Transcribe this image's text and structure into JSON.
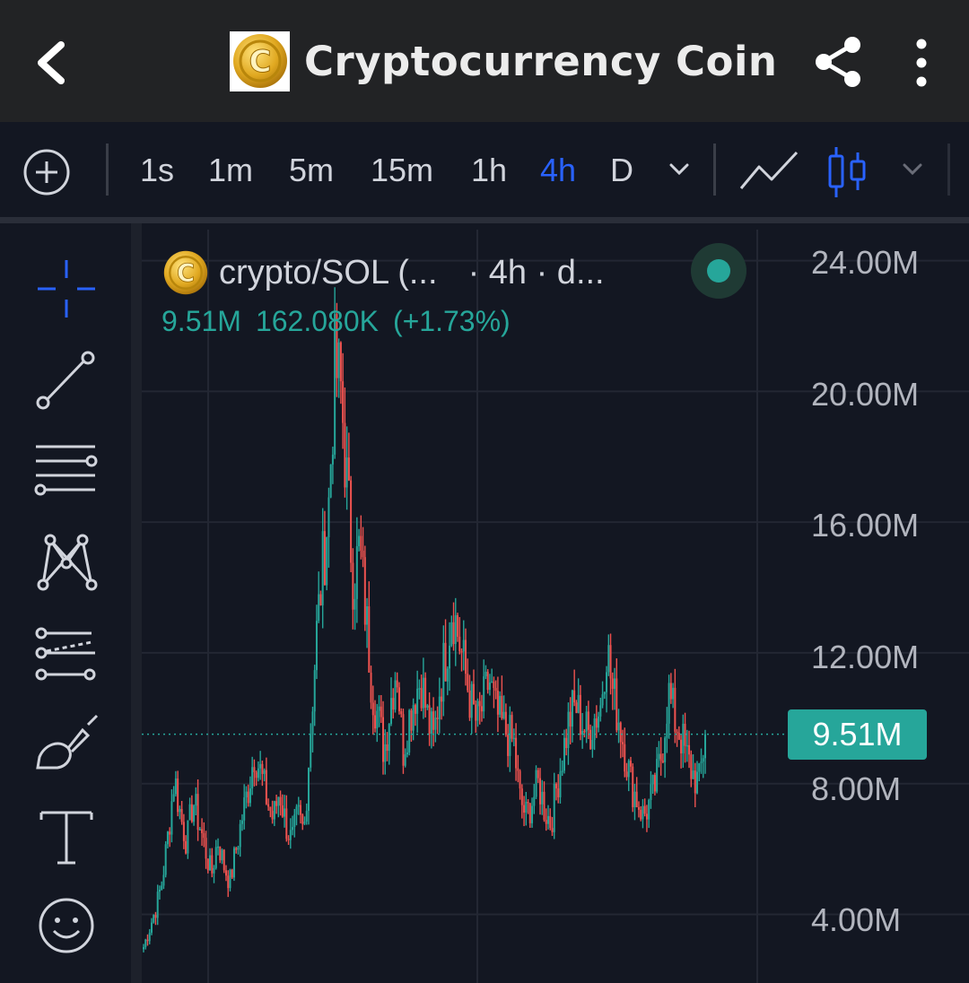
{
  "header": {
    "title": "Cryptocurrency Coin",
    "back_icon": "chevron-left-icon",
    "share_icon": "share-icon",
    "more_icon": "more-vertical-icon",
    "logo_letter": "C"
  },
  "toolbar": {
    "intervals": [
      "1s",
      "1m",
      "5m",
      "15m",
      "1h",
      "4h",
      "D"
    ],
    "active_interval": "4h",
    "accent_color": "#2962ff"
  },
  "sidebar": {
    "tools": [
      "crosshair-icon",
      "trend-line-icon",
      "horizontal-lines-icon",
      "pattern-icon",
      "projection-icon",
      "brush-icon",
      "text-icon",
      "emoji-icon"
    ]
  },
  "legend": {
    "symbol": "crypto/SOL (...",
    "interval": "· 4h · d...",
    "last_price": "9.51M",
    "change": "162.080K",
    "change_pct": "(+1.73%)",
    "status_color": "#26a69a"
  },
  "chart_data": {
    "type": "candlestick",
    "price_axis_labels": [
      "24.00M",
      "20.00M",
      "16.00M",
      "12.00M",
      "8.00M",
      "4.00M"
    ],
    "price_axis_values": [
      24,
      20,
      16,
      12,
      8,
      4
    ],
    "ylim": [
      1.9,
      24.95
    ],
    "last_price": 9.51,
    "last_price_label": "9.51M",
    "up_color": "#26a69a",
    "down_color": "#ef5350",
    "grid": true,
    "close_series": [
      3.0,
      3.6,
      4.2,
      5.0,
      6.5,
      8.2,
      7.0,
      6.2,
      7.5,
      6.8,
      6.0,
      5.2,
      6.3,
      5.5,
      5.0,
      6.0,
      7.0,
      7.9,
      9.0,
      8.3,
      7.5,
      6.9,
      7.8,
      6.8,
      6.2,
      7.0,
      6.5,
      9.5,
      12.5,
      14.6,
      16.5,
      20.8,
      20.0,
      17.0,
      14.2,
      15.2,
      13.2,
      11.0,
      10.0,
      9.0,
      10.5,
      11.7,
      9.0,
      10.0,
      10.8,
      11.2,
      10.0,
      9.3,
      11.0,
      12.0,
      13.5,
      12.5,
      11.5,
      10.5,
      9.8,
      10.4,
      11.2,
      10.2,
      9.8,
      9.5,
      9.2,
      7.5,
      7.0,
      7.5,
      8.0,
      7.2,
      6.8,
      8.0,
      9.0,
      10.0,
      10.4,
      9.9,
      9.5,
      10.0,
      10.3,
      12.3,
      10.8,
      10.0,
      9.0,
      8.0,
      7.5,
      7.0,
      7.4,
      8.0,
      9.0,
      10.8,
      10.0,
      9.5,
      8.8,
      8.3,
      8.0,
      9.51
    ]
  }
}
